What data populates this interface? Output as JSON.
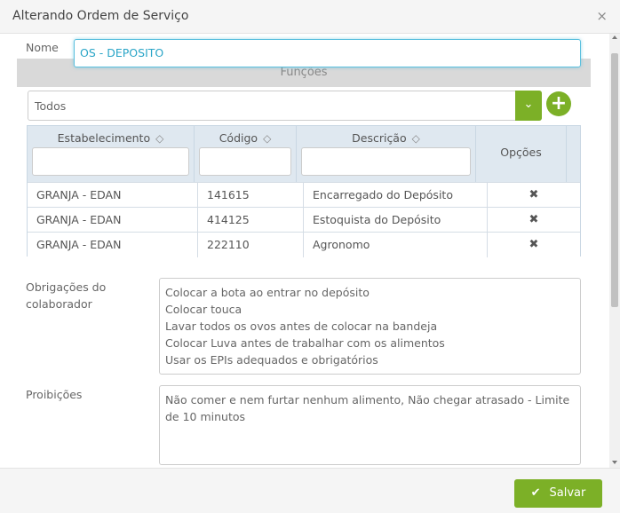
{
  "window": {
    "title": "Alterando Ordem de Serviço",
    "close_icon": "×"
  },
  "form": {
    "nome_label": "Nome",
    "nome_value": "OS - DEPOSITO",
    "funcoes_title": "Funções",
    "funcao_select": {
      "value": "Todos",
      "arrow": "⌄",
      "add": "+"
    },
    "obrigacoes_label_line1": "Obrigações do",
    "obrigacoes_label_line2": "colaborador",
    "obrigacoes_text": "Colocar a bota ao entrar no depósito\nColocar touca\nLavar todos os ovos antes de colocar na bandeja\nColocar Luva antes de trabalhar com os alimentos\nUsar os EPIs adequados e obrigatórios",
    "proibicoes_label": "Proibições",
    "proibicoes_text": "Não comer e nem furtar nenhum alimento, Não chegar atrasado - Limite de 10 minutos"
  },
  "grid": {
    "columns": [
      "Estabelecimento",
      "Código",
      "Descrição",
      "Opções"
    ],
    "sort_icon": "◇",
    "delete_icon": "✖",
    "rows": [
      {
        "estabelecimento": "GRANJA - EDAN",
        "codigo": "141615",
        "descricao": "Encarregado do Depósito"
      },
      {
        "estabelecimento": "GRANJA - EDAN",
        "codigo": "414125",
        "descricao": "Estoquista do Depósito"
      },
      {
        "estabelecimento": "GRANJA - EDAN",
        "codigo": "222110",
        "descricao": "Agronomo"
      }
    ]
  },
  "footer": {
    "save_label": "Salvar",
    "check_icon": "✔"
  },
  "colors": {
    "accent": "#7cb027",
    "focus": "#5bc0de",
    "grid_header": "#dfe8f0"
  }
}
